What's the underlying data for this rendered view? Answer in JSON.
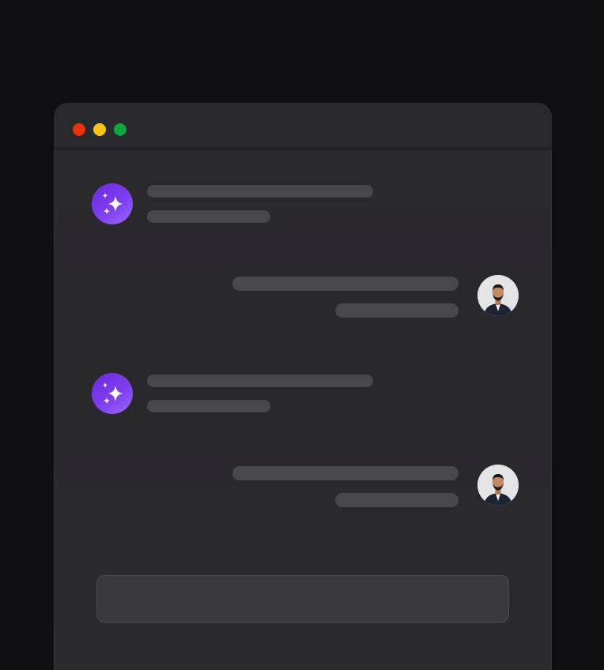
{
  "window": {
    "controls": [
      {
        "name": "close",
        "color": "#e8310d"
      },
      {
        "name": "minimize",
        "color": "#f4c417"
      },
      {
        "name": "zoom",
        "color": "#12a33f"
      }
    ]
  },
  "colors": {
    "background": "#0f0e13",
    "window": "#2a292e",
    "placeholder_bar": "#48474c",
    "assistant_avatar": "#7f3df0"
  },
  "messages": [
    {
      "role": "assistant",
      "icon": "sparkles-icon",
      "lines": 2
    },
    {
      "role": "user",
      "icon": "user-photo-avatar",
      "lines": 2
    },
    {
      "role": "assistant",
      "icon": "sparkles-icon",
      "lines": 2
    },
    {
      "role": "user",
      "icon": "user-photo-avatar",
      "lines": 2
    }
  ],
  "composer": {
    "placeholder": ""
  }
}
